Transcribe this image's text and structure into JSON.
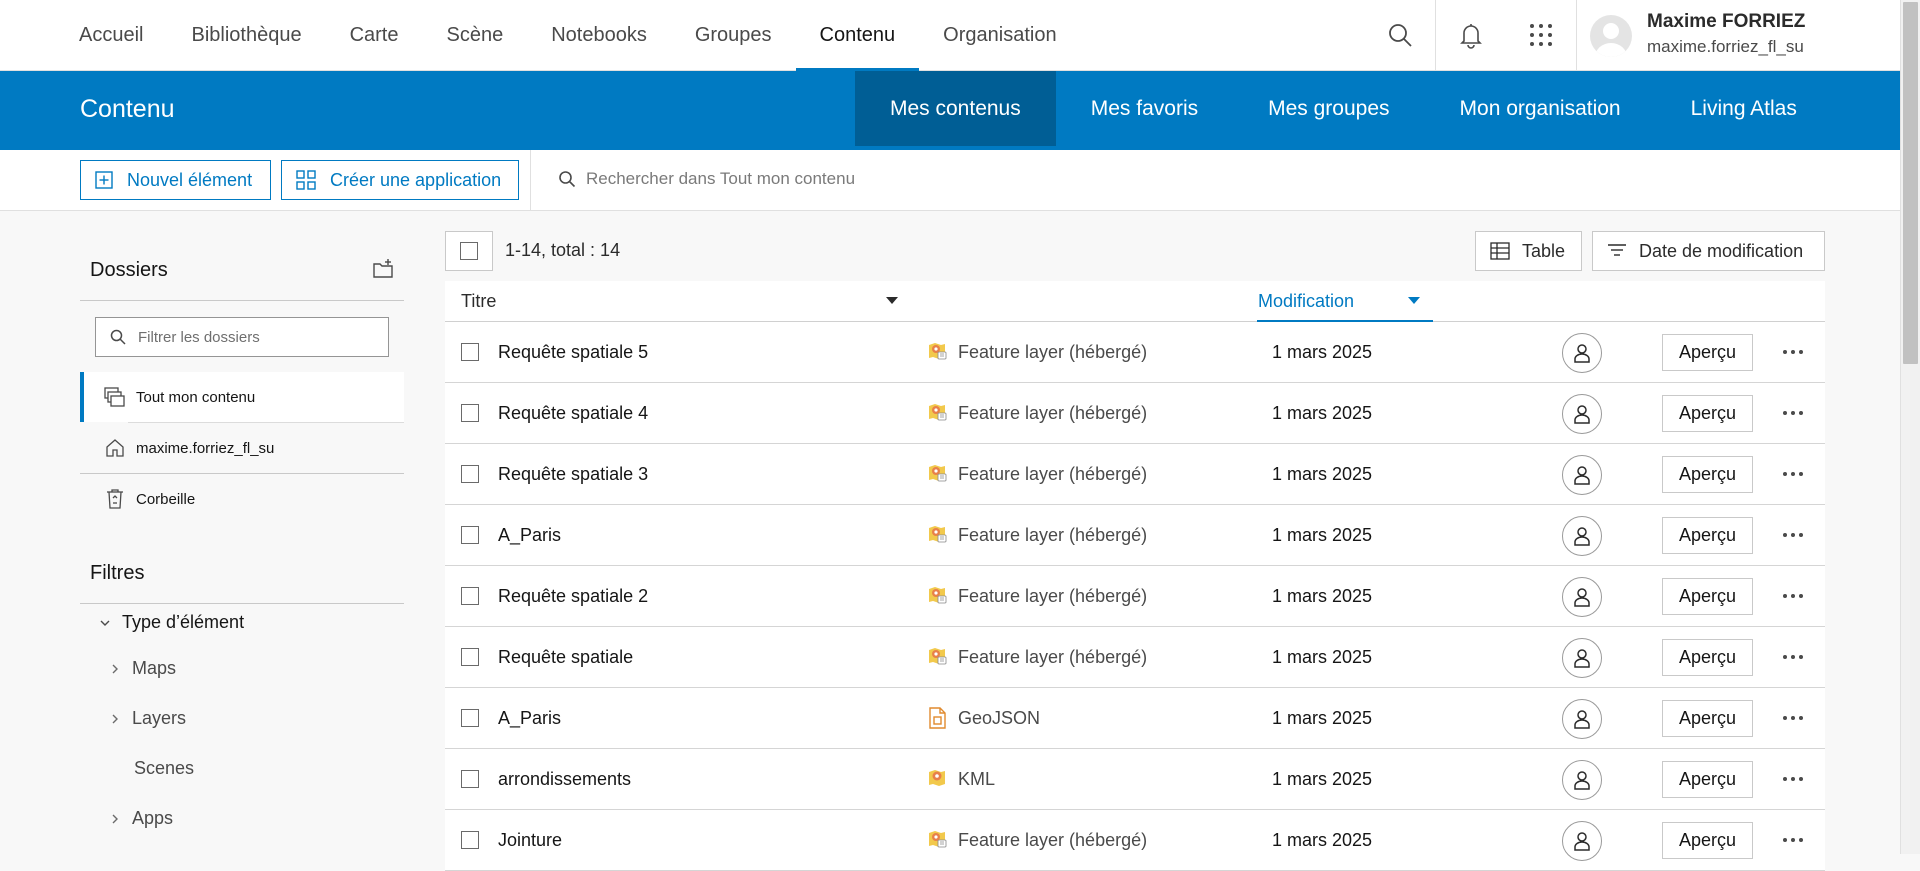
{
  "nav": {
    "links": [
      "Accueil",
      "Bibliothèque",
      "Carte",
      "Scène",
      "Notebooks",
      "Groupes",
      "Contenu",
      "Organisation"
    ],
    "active_link": "Contenu",
    "user_name": "Maxime FORRIEZ",
    "user_id": "maxime.forriez_fl_su",
    "icons": [
      "search-icon",
      "bell-icon",
      "app-launcher-icon"
    ]
  },
  "header": {
    "title": "Contenu",
    "tabs": [
      "Mes contenus",
      "Mes favoris",
      "Mes groupes",
      "Mon organisation",
      "Living Atlas"
    ],
    "active_tab": "Mes contenus",
    "accent": "#007ac2",
    "active_tab_bg": "#005e95"
  },
  "actions": {
    "new_item": "Nouvel élément",
    "create_app": "Créer une application",
    "search_placeholder": "Rechercher dans Tout mon contenu"
  },
  "sidebar": {
    "folders_heading": "Dossiers",
    "filter_placeholder": "Filtrer les dossiers",
    "folders": [
      {
        "label": "Tout mon contenu",
        "icon": "all-content-icon",
        "active": true
      },
      {
        "label": "maxime.forriez_fl_su",
        "icon": "home-icon",
        "active": false
      },
      {
        "label": "Corbeille",
        "icon": "recycle-bin-icon",
        "active": false
      }
    ],
    "filters_heading": "Filtres",
    "facet_group": "Type d’élément",
    "facets": [
      {
        "label": "Maps",
        "expandable": true
      },
      {
        "label": "Layers",
        "expandable": true
      },
      {
        "label": "Scenes",
        "expandable": false
      },
      {
        "label": "Apps",
        "expandable": true
      }
    ]
  },
  "list": {
    "count_text": "1-14, total : 14",
    "view_button": "Table",
    "sort_button": "Date de modification",
    "columns": {
      "title": "Titre",
      "modified": "Modification"
    },
    "preview_label": "Aperçu",
    "rows": [
      {
        "name": "Requête spatiale 5",
        "type": "Feature layer (hébergé)",
        "icon": "feature-layer-icon",
        "date": "1 mars 2025"
      },
      {
        "name": "Requête spatiale 4",
        "type": "Feature layer (hébergé)",
        "icon": "feature-layer-icon",
        "date": "1 mars 2025"
      },
      {
        "name": "Requête spatiale 3",
        "type": "Feature layer (hébergé)",
        "icon": "feature-layer-icon",
        "date": "1 mars 2025"
      },
      {
        "name": "A_Paris",
        "type": "Feature layer (hébergé)",
        "icon": "feature-layer-icon",
        "date": "1 mars 2025"
      },
      {
        "name": "Requête spatiale 2",
        "type": "Feature layer (hébergé)",
        "icon": "feature-layer-icon",
        "date": "1 mars 2025"
      },
      {
        "name": "Requête spatiale",
        "type": "Feature layer (hébergé)",
        "icon": "feature-layer-icon",
        "date": "1 mars 2025"
      },
      {
        "name": "A_Paris",
        "type": "GeoJSON",
        "icon": "geojson-icon",
        "date": "1 mars 2025"
      },
      {
        "name": "arrondissements",
        "type": "KML",
        "icon": "kml-icon",
        "date": "1 mars 2025"
      },
      {
        "name": "Jointure",
        "type": "Feature layer (hébergé)",
        "icon": "feature-layer-icon",
        "date": "1 mars 2025"
      }
    ]
  }
}
